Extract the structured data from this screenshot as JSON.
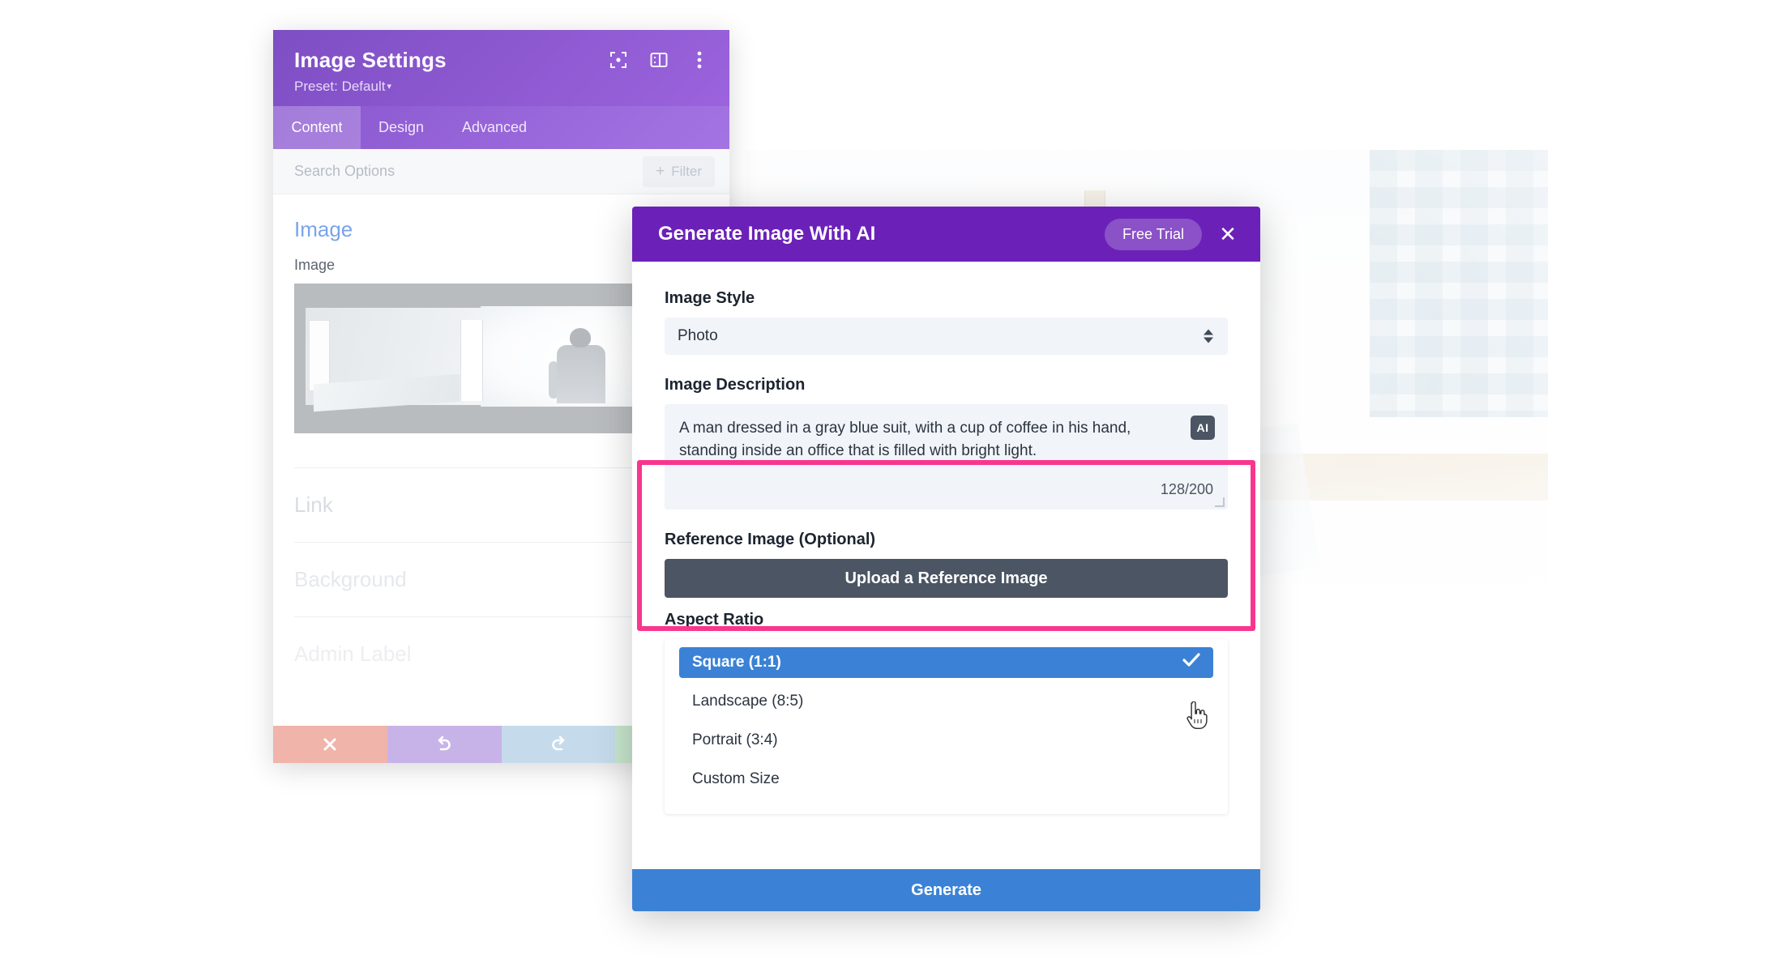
{
  "settings_panel": {
    "title": "Image Settings",
    "preset_label": "Preset: Default",
    "preset_caret": "▾",
    "header_icons": [
      {
        "name": "focus-icon"
      },
      {
        "name": "layout-panel-icon"
      },
      {
        "name": "more-vertical-icon"
      }
    ],
    "tabs": [
      {
        "label": "Content",
        "active": true
      },
      {
        "label": "Design",
        "active": false
      },
      {
        "label": "Advanced",
        "active": false
      }
    ],
    "search_placeholder": "Search Options",
    "filter_label": "Filter",
    "filter_plus": "+",
    "sections": {
      "image_open": "Image",
      "image_field_label": "Image",
      "link": "Link",
      "background": "Background",
      "admin_label": "Admin Label"
    },
    "footer_buttons": [
      {
        "name": "cancel-button",
        "icon": "close-icon"
      },
      {
        "name": "undo-button",
        "icon": "undo-icon"
      },
      {
        "name": "redo-button",
        "icon": "redo-icon"
      },
      {
        "name": "save-button",
        "icon": "check-icon"
      }
    ]
  },
  "ai_modal": {
    "title": "Generate Image With AI",
    "trial_badge": "Free Trial",
    "close_glyph": "✕",
    "image_style": {
      "label": "Image Style",
      "value": "Photo"
    },
    "image_description": {
      "label": "Image Description",
      "value": "A man dressed in a gray blue suit, with a cup of coffee in his hand, standing inside an office that is filled with bright light.",
      "ai_badge": "AI",
      "counter": "128/200"
    },
    "reference_image": {
      "label": "Reference Image (Optional)",
      "upload_label": "Upload a Reference Image"
    },
    "aspect_ratio": {
      "label": "Aspect Ratio",
      "selected": "Square (1:1)",
      "options": [
        {
          "label": "Square (1:1)",
          "selected": true
        },
        {
          "label": "Landscape (8:5)",
          "selected": false
        },
        {
          "label": "Portrait (3:4)",
          "selected": false
        },
        {
          "label": "Custom Size",
          "selected": false
        }
      ]
    },
    "generate_label": "Generate"
  },
  "colors": {
    "modal_header_purple": "#6b21b8",
    "panel_header_purple": "#8a57cf",
    "accent_blue": "#3b82d6",
    "highlight_pink": "#f9368e",
    "upload_dark": "#4b5563"
  }
}
